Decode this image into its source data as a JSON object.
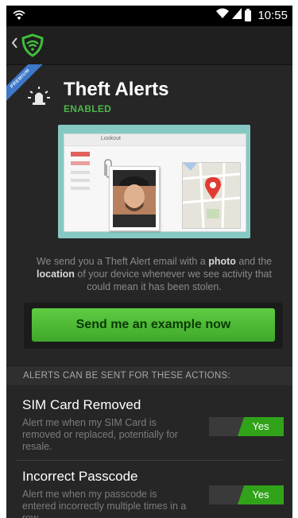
{
  "status_bar": {
    "time": "10:55"
  },
  "ribbon": {
    "label": "PREMIUM"
  },
  "header": {
    "title": "Theft Alerts",
    "status": "ENABLED"
  },
  "illustration": {
    "browser_brand": "Lookout"
  },
  "description": {
    "part1": "We send you a Theft Alert email with a ",
    "bold1": "photo",
    "part2": " and the ",
    "bold2": "location",
    "part3": " of your device whenever we see activity that could mean it has been stolen."
  },
  "example_button": {
    "label": "Send me an example now"
  },
  "section": {
    "header": "ALERTS CAN BE SENT FOR THESE ACTIONS:"
  },
  "alerts": [
    {
      "title": "SIM Card Removed",
      "description": "Alert me when my SIM Card is removed or replaced, potentially for resale.",
      "toggle": "Yes"
    },
    {
      "title": "Incorrect Passcode",
      "description": "Alert me when my passcode is entered incorrectly multiple times in a row.",
      "toggle": "Yes"
    }
  ],
  "colors": {
    "accent": "#4cb848",
    "button": "#4fb935",
    "toggle_on": "#31a31a",
    "ribbon": "#3d78c9"
  },
  "icons": [
    "wifi-icon",
    "signal-icon",
    "battery-icon",
    "back-chevron-icon",
    "lookout-shield-icon",
    "alarm-light-icon",
    "paperclip-icon",
    "map-pin-icon"
  ]
}
